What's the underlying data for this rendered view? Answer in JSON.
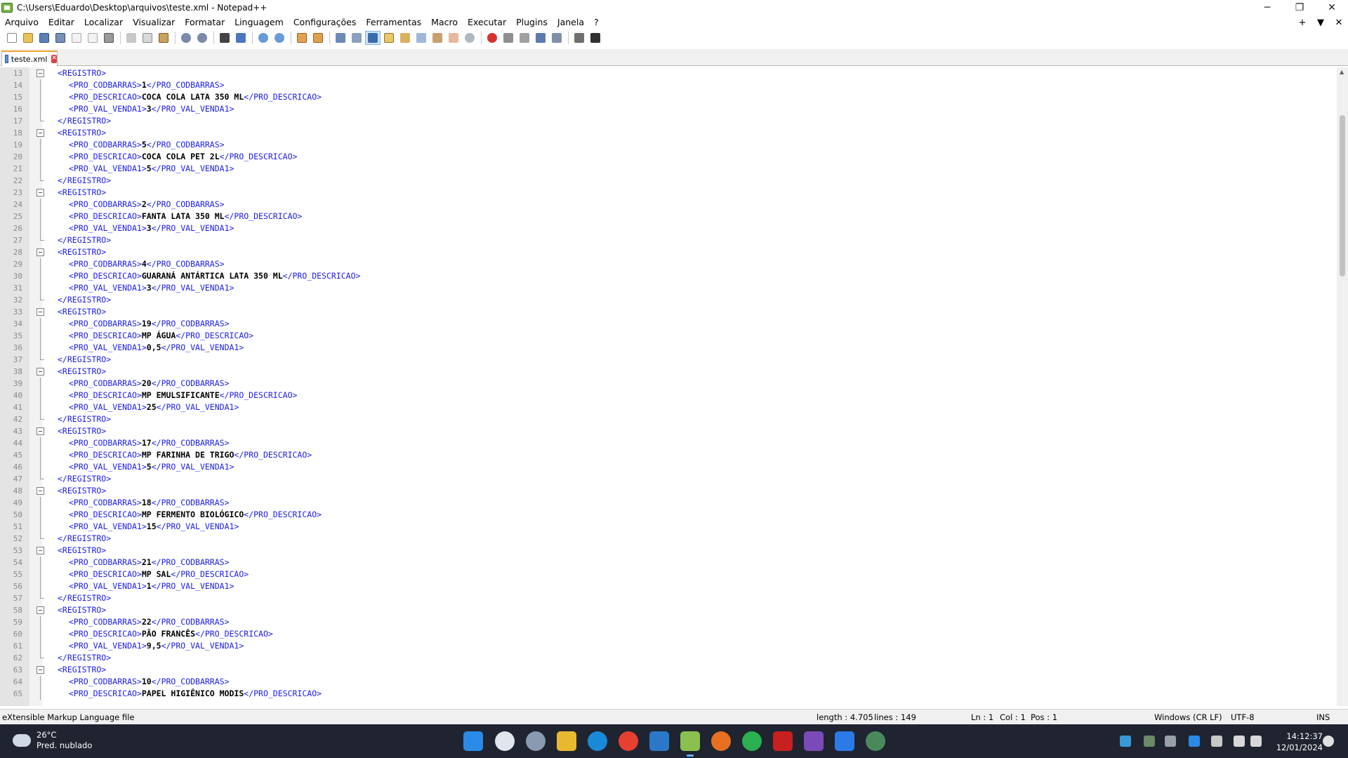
{
  "window": {
    "title": "C:\\Users\\Eduardo\\Desktop\\arquivos\\teste.xml - Notepad++",
    "minimize": "─",
    "maximize": "❐",
    "close": "✕"
  },
  "menu": {
    "items": [
      "Arquivo",
      "Editar",
      "Localizar",
      "Visualizar",
      "Formatar",
      "Linguagem",
      "Configurações",
      "Ferramentas",
      "Macro",
      "Executar",
      "Plugins",
      "Janela",
      "?"
    ],
    "right": [
      "+",
      "▼",
      "✕"
    ]
  },
  "tab": {
    "label": "teste.xml",
    "close": "✕"
  },
  "editor": {
    "lines": [
      {
        "n": "13",
        "indent": false,
        "fold": "open",
        "tag1": "<REGISTRO>",
        "text": "",
        "tag2": ""
      },
      {
        "n": "14",
        "indent": true,
        "fold": "line",
        "tag1": "<PRO_CODBARRAS>",
        "text": "1",
        "tag2": "</PRO_CODBARRAS>"
      },
      {
        "n": "15",
        "indent": true,
        "fold": "line",
        "tag1": "<PRO_DESCRICAO>",
        "text": "COCA COLA LATA 350 ML",
        "tag2": "</PRO_DESCRICAO>"
      },
      {
        "n": "16",
        "indent": true,
        "fold": "line",
        "tag1": "<PRO_VAL_VENDA1>",
        "text": "3",
        "tag2": "</PRO_VAL_VENDA1>"
      },
      {
        "n": "17",
        "indent": false,
        "fold": "end",
        "tag1": "</REGISTRO>",
        "text": "",
        "tag2": ""
      },
      {
        "n": "18",
        "indent": false,
        "fold": "open",
        "tag1": "<REGISTRO>",
        "text": "",
        "tag2": ""
      },
      {
        "n": "19",
        "indent": true,
        "fold": "line",
        "tag1": "<PRO_CODBARRAS>",
        "text": "5",
        "tag2": "</PRO_CODBARRAS>"
      },
      {
        "n": "20",
        "indent": true,
        "fold": "line",
        "tag1": "<PRO_DESCRICAO>",
        "text": "COCA COLA PET 2L",
        "tag2": "</PRO_DESCRICAO>"
      },
      {
        "n": "21",
        "indent": true,
        "fold": "line",
        "tag1": "<PRO_VAL_VENDA1>",
        "text": "5",
        "tag2": "</PRO_VAL_VENDA1>"
      },
      {
        "n": "22",
        "indent": false,
        "fold": "end",
        "tag1": "</REGISTRO>",
        "text": "",
        "tag2": ""
      },
      {
        "n": "23",
        "indent": false,
        "fold": "open",
        "tag1": "<REGISTRO>",
        "text": "",
        "tag2": ""
      },
      {
        "n": "24",
        "indent": true,
        "fold": "line",
        "tag1": "<PRO_CODBARRAS>",
        "text": "2",
        "tag2": "</PRO_CODBARRAS>"
      },
      {
        "n": "25",
        "indent": true,
        "fold": "line",
        "tag1": "<PRO_DESCRICAO>",
        "text": "FANTA LATA 350 ML",
        "tag2": "</PRO_DESCRICAO>"
      },
      {
        "n": "26",
        "indent": true,
        "fold": "line",
        "tag1": "<PRO_VAL_VENDA1>",
        "text": "3",
        "tag2": "</PRO_VAL_VENDA1>"
      },
      {
        "n": "27",
        "indent": false,
        "fold": "end",
        "tag1": "</REGISTRO>",
        "text": "",
        "tag2": ""
      },
      {
        "n": "28",
        "indent": false,
        "fold": "open",
        "tag1": "<REGISTRO>",
        "text": "",
        "tag2": ""
      },
      {
        "n": "29",
        "indent": true,
        "fold": "line",
        "tag1": "<PRO_CODBARRAS>",
        "text": "4",
        "tag2": "</PRO_CODBARRAS>"
      },
      {
        "n": "30",
        "indent": true,
        "fold": "line",
        "tag1": "<PRO_DESCRICAO>",
        "text": "GUARANÁ ANTÁRTICA LATA 350 ML",
        "tag2": "</PRO_DESCRICAO>"
      },
      {
        "n": "31",
        "indent": true,
        "fold": "line",
        "tag1": "<PRO_VAL_VENDA1>",
        "text": "3",
        "tag2": "</PRO_VAL_VENDA1>"
      },
      {
        "n": "32",
        "indent": false,
        "fold": "end",
        "tag1": "</REGISTRO>",
        "text": "",
        "tag2": ""
      },
      {
        "n": "33",
        "indent": false,
        "fold": "open",
        "tag1": "<REGISTRO>",
        "text": "",
        "tag2": ""
      },
      {
        "n": "34",
        "indent": true,
        "fold": "line",
        "tag1": "<PRO_CODBARRAS>",
        "text": "19",
        "tag2": "</PRO_CODBARRAS>"
      },
      {
        "n": "35",
        "indent": true,
        "fold": "line",
        "tag1": "<PRO_DESCRICAO>",
        "text": "MP ÁGUA",
        "tag2": "</PRO_DESCRICAO>"
      },
      {
        "n": "36",
        "indent": true,
        "fold": "line",
        "tag1": "<PRO_VAL_VENDA1>",
        "text": "0,5",
        "tag2": "</PRO_VAL_VENDA1>"
      },
      {
        "n": "37",
        "indent": false,
        "fold": "end",
        "tag1": "</REGISTRO>",
        "text": "",
        "tag2": ""
      },
      {
        "n": "38",
        "indent": false,
        "fold": "open",
        "tag1": "<REGISTRO>",
        "text": "",
        "tag2": ""
      },
      {
        "n": "39",
        "indent": true,
        "fold": "line",
        "tag1": "<PRO_CODBARRAS>",
        "text": "20",
        "tag2": "</PRO_CODBARRAS>"
      },
      {
        "n": "40",
        "indent": true,
        "fold": "line",
        "tag1": "<PRO_DESCRICAO>",
        "text": "MP EMULSIFICANTE",
        "tag2": "</PRO_DESCRICAO>"
      },
      {
        "n": "41",
        "indent": true,
        "fold": "line",
        "tag1": "<PRO_VAL_VENDA1>",
        "text": "25",
        "tag2": "</PRO_VAL_VENDA1>"
      },
      {
        "n": "42",
        "indent": false,
        "fold": "end",
        "tag1": "</REGISTRO>",
        "text": "",
        "tag2": ""
      },
      {
        "n": "43",
        "indent": false,
        "fold": "open",
        "tag1": "<REGISTRO>",
        "text": "",
        "tag2": ""
      },
      {
        "n": "44",
        "indent": true,
        "fold": "line",
        "tag1": "<PRO_CODBARRAS>",
        "text": "17",
        "tag2": "</PRO_CODBARRAS>"
      },
      {
        "n": "45",
        "indent": true,
        "fold": "line",
        "tag1": "<PRO_DESCRICAO>",
        "text": "MP FARINHA DE TRIGO",
        "tag2": "</PRO_DESCRICAO>"
      },
      {
        "n": "46",
        "indent": true,
        "fold": "line",
        "tag1": "<PRO_VAL_VENDA1>",
        "text": "5",
        "tag2": "</PRO_VAL_VENDA1>"
      },
      {
        "n": "47",
        "indent": false,
        "fold": "end",
        "tag1": "</REGISTRO>",
        "text": "",
        "tag2": ""
      },
      {
        "n": "48",
        "indent": false,
        "fold": "open",
        "tag1": "<REGISTRO>",
        "text": "",
        "tag2": ""
      },
      {
        "n": "49",
        "indent": true,
        "fold": "line",
        "tag1": "<PRO_CODBARRAS>",
        "text": "18",
        "tag2": "</PRO_CODBARRAS>"
      },
      {
        "n": "50",
        "indent": true,
        "fold": "line",
        "tag1": "<PRO_DESCRICAO>",
        "text": "MP FERMENTO BIOLÓGICO",
        "tag2": "</PRO_DESCRICAO>"
      },
      {
        "n": "51",
        "indent": true,
        "fold": "line",
        "tag1": "<PRO_VAL_VENDA1>",
        "text": "15",
        "tag2": "</PRO_VAL_VENDA1>"
      },
      {
        "n": "52",
        "indent": false,
        "fold": "end",
        "tag1": "</REGISTRO>",
        "text": "",
        "tag2": ""
      },
      {
        "n": "53",
        "indent": false,
        "fold": "open",
        "tag1": "<REGISTRO>",
        "text": "",
        "tag2": ""
      },
      {
        "n": "54",
        "indent": true,
        "fold": "line",
        "tag1": "<PRO_CODBARRAS>",
        "text": "21",
        "tag2": "</PRO_CODBARRAS>"
      },
      {
        "n": "55",
        "indent": true,
        "fold": "line",
        "tag1": "<PRO_DESCRICAO>",
        "text": "MP SAL",
        "tag2": "</PRO_DESCRICAO>"
      },
      {
        "n": "56",
        "indent": true,
        "fold": "line",
        "tag1": "<PRO_VAL_VENDA1>",
        "text": "1",
        "tag2": "</PRO_VAL_VENDA1>"
      },
      {
        "n": "57",
        "indent": false,
        "fold": "end",
        "tag1": "</REGISTRO>",
        "text": "",
        "tag2": ""
      },
      {
        "n": "58",
        "indent": false,
        "fold": "open",
        "tag1": "<REGISTRO>",
        "text": "",
        "tag2": ""
      },
      {
        "n": "59",
        "indent": true,
        "fold": "line",
        "tag1": "<PRO_CODBARRAS>",
        "text": "22",
        "tag2": "</PRO_CODBARRAS>"
      },
      {
        "n": "60",
        "indent": true,
        "fold": "line",
        "tag1": "<PRO_DESCRICAO>",
        "text": "PÃO FRANCÊS",
        "tag2": "</PRO_DESCRICAO>"
      },
      {
        "n": "61",
        "indent": true,
        "fold": "line",
        "tag1": "<PRO_VAL_VENDA1>",
        "text": "9,5",
        "tag2": "</PRO_VAL_VENDA1>"
      },
      {
        "n": "62",
        "indent": false,
        "fold": "end",
        "tag1": "</REGISTRO>",
        "text": "",
        "tag2": ""
      },
      {
        "n": "63",
        "indent": false,
        "fold": "open",
        "tag1": "<REGISTRO>",
        "text": "",
        "tag2": ""
      },
      {
        "n": "64",
        "indent": true,
        "fold": "line",
        "tag1": "<PRO_CODBARRAS>",
        "text": "10",
        "tag2": "</PRO_CODBARRAS>"
      },
      {
        "n": "65",
        "indent": true,
        "fold": "line",
        "tag1": "<PRO_DESCRICAO>",
        "text": "PAPEL HIGIÊNICO MODIS",
        "tag2": "</PRO_DESCRICAO>"
      }
    ]
  },
  "status": {
    "file_type": "eXtensible Markup Language file",
    "length": "length : 4.705",
    "lines": "lines : 149",
    "ln": "Ln : 1",
    "col": "Col : 1",
    "pos": "Pos : 1",
    "eol": "Windows (CR LF)",
    "encoding": "UTF-8",
    "mode": "INS"
  },
  "taskbar": {
    "weather_temp": "26°C",
    "weather_desc": "Pred. nublado",
    "time": "14:12:37",
    "date": "12/01/2024"
  },
  "colors": {
    "tag": "#1c1ce8",
    "text": "#000000",
    "taskbar": "#1f2430",
    "tab_accent": "#f0a030"
  }
}
